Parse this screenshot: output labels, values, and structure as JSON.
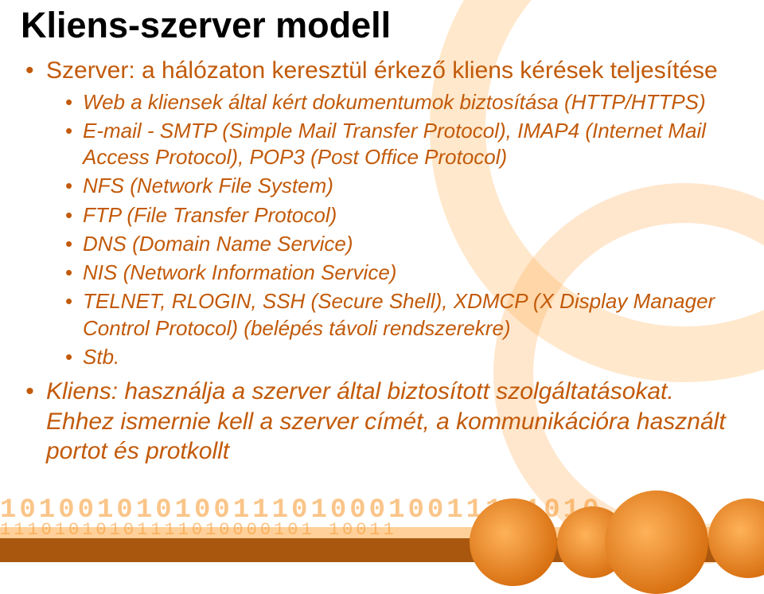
{
  "title": "Kliens-szerver modell",
  "bullets": {
    "server_intro": "Szerver: a hálózaton keresztül érkező kliens kérések teljesítése",
    "server_items": [
      "Web a kliensek által kért dokumentumok biztosítása (HTTP/HTTPS)",
      "E-mail - SMTP (Simple Mail Transfer Protocol), IMAP4 (Internet Mail Access Protocol), POP3 (Post Office Protocol)",
      "NFS (Network File System)",
      "FTP (File Transfer Protocol)",
      "DNS (Domain Name Service)",
      "NIS (Network Information Service)",
      "TELNET, RLOGIN, SSH (Secure Shell), XDMCP (X Display Manager Control Protocol)  (belépés távoli rendszerekre)",
      "Stb."
    ],
    "client": "Kliens: használja a szerver által biztosított szolgáltatásokat. Ehhez ismernie kell a szerver címét, a kommunikációra használt portot és protkollt"
  },
  "footer": {
    "binary_top": "1010010101001110100010011101010",
    "binary_bot": "11101010101111010000101  10011"
  }
}
